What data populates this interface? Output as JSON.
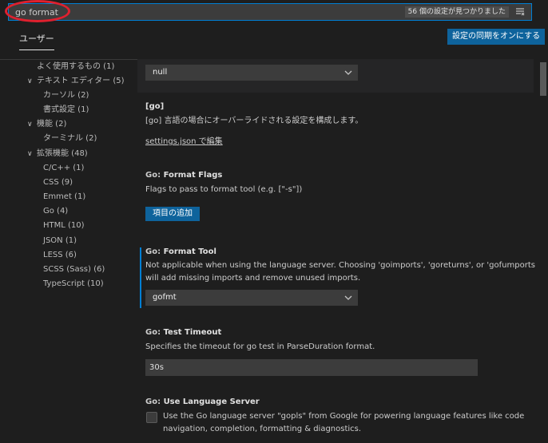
{
  "search": {
    "value": "go format",
    "result_count": "56 個の設定が見つかりました"
  },
  "tabs": {
    "user": "ユーザー"
  },
  "sync_button": "設定の同期をオンにする",
  "toc": [
    {
      "label": "よく使用するもの (1)",
      "chevron": ""
    },
    {
      "label": "テキスト エディター (5)",
      "chevron": "∨"
    },
    {
      "label": "カーソル (2)",
      "chevron": ""
    },
    {
      "label": "書式設定 (1)",
      "chevron": ""
    },
    {
      "label": "機能 (2)",
      "chevron": "∨"
    },
    {
      "label": "ターミナル (2)",
      "chevron": ""
    },
    {
      "label": "拡張機能 (48)",
      "chevron": "∨"
    },
    {
      "label": "C/C++ (1)",
      "chevron": ""
    },
    {
      "label": "CSS (9)",
      "chevron": ""
    },
    {
      "label": "Emmet (1)",
      "chevron": ""
    },
    {
      "label": "Go (4)",
      "chevron": ""
    },
    {
      "label": "HTML (10)",
      "chevron": ""
    },
    {
      "label": "JSON (1)",
      "chevron": ""
    },
    {
      "label": "LESS (6)",
      "chevron": ""
    },
    {
      "label": "SCSS (Sass) (6)",
      "chevron": ""
    },
    {
      "label": "TypeScript (10)",
      "chevron": ""
    }
  ],
  "settings": {
    "null_dropdown": {
      "value": "null"
    },
    "go_override": {
      "title": "[go]",
      "description": "[go] 言語の場合にオーバーライドされる設定を構成します。",
      "link": "settings.json で編集"
    },
    "format_flags": {
      "category": "Go: ",
      "name": "Format Flags",
      "description": "Flags to pass to format tool (e.g. [\"-s\"])",
      "button": "項目の追加"
    },
    "format_tool": {
      "category": "Go: ",
      "name": "Format Tool",
      "description_line1": "Not applicable when using the language server. Choosing 'goimports', 'goreturns', or 'gofumports'",
      "description_line2": "will add missing imports and remove unused imports.",
      "value": "gofmt"
    },
    "test_timeout": {
      "category": "Go: ",
      "name": "Test Timeout",
      "description": "Specifies the timeout for go test in ParseDuration format.",
      "value": "30s"
    },
    "use_language_server": {
      "category": "Go: ",
      "name": "Use Language Server",
      "description_line1": "Use the Go language server \"gopls\" from Google for powering language features like code",
      "description_line2": "navigation, completion, formatting & diagnostics."
    }
  },
  "colors": {
    "background": "#1e1e1e",
    "accent": "#007fd4",
    "button": "#0e639c",
    "annotation": "#e0202e"
  },
  "icons": [
    "filter-icon",
    "chevron-down-icon"
  ]
}
